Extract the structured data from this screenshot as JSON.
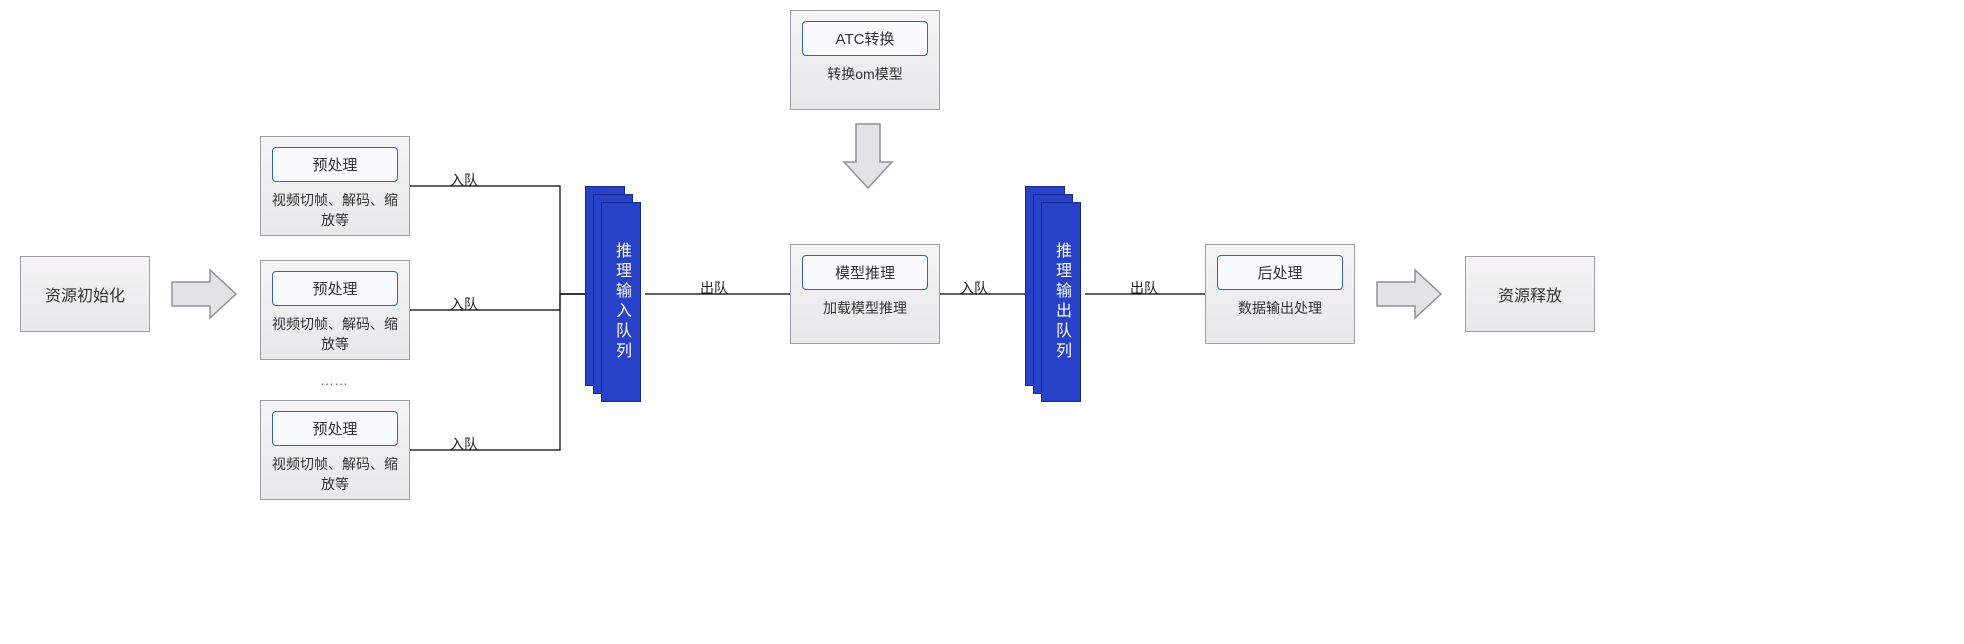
{
  "nodes": {
    "init": {
      "label": "资源初始化"
    },
    "release": {
      "label": "资源释放"
    },
    "preprocess": {
      "chip": "预处理",
      "sub": "视频切帧、解码、缩放等"
    },
    "ellipsis": "……",
    "inQueue": {
      "label": "推理输入队列"
    },
    "outQueue": {
      "label": "推理输出队列"
    },
    "infer": {
      "chip": "模型推理",
      "sub": "加载模型推理"
    },
    "atc": {
      "chip": "ATC转换",
      "sub": "转换om模型"
    },
    "post": {
      "chip": "后处理",
      "sub": "数据输出处理"
    }
  },
  "edgeLabels": {
    "enqueue": "入队",
    "dequeue": "出队"
  }
}
